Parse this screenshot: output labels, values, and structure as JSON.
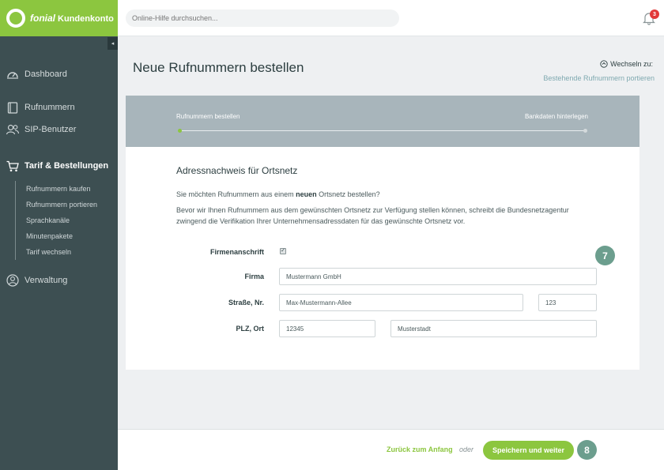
{
  "brand": {
    "name_italic": "fonial",
    "name_rest": "Kundenkonto"
  },
  "search": {
    "placeholder": "Online-Hilfe durchsuchen..."
  },
  "notifications": {
    "count": "3"
  },
  "sidebar": {
    "collapse_icon": "◂",
    "items": [
      {
        "label": "Dashboard",
        "icon": "speedometer-icon"
      },
      {
        "label": "Rufnummern",
        "icon": "phone-book-icon"
      },
      {
        "label": "SIP-Benutzer",
        "icon": "users-icon"
      },
      {
        "label": "Tarif & Bestellungen",
        "icon": "cart-icon"
      },
      {
        "label": "Verwaltung",
        "icon": "user-circle-icon"
      }
    ],
    "submenu": [
      "Rufnummern kaufen",
      "Rufnummern portieren",
      "Sprachkanäle",
      "Minutenpakete",
      "Tarif wechseln"
    ]
  },
  "header": {
    "title": "Neue Rufnummern bestellen",
    "switch_label": "Wechseln zu:",
    "switch_link": "Bestehende Rufnummern portieren"
  },
  "stepper": {
    "step1": "Rufnummern bestellen",
    "step2": "Bankdaten hinterlegen",
    "colors": {
      "active": "#8cc63f",
      "inactive": "#e8edef"
    }
  },
  "form": {
    "section_title": "Adressnachweis für Ortsnetz",
    "intro_pre": "Sie möchten Rufnummern aus einem ",
    "intro_bold": "neuen",
    "intro_post": " Ortsnetz bestellen?",
    "intro_line2": "Bevor wir Ihnen Rufnummern aus dem gewünschten Ortsnetz zur Verfügung stellen können, schreibt die Bundesnetzagentur",
    "intro_line3": "zwingend die Verifikation Ihrer Unternehmensadressdaten für das gewünschte Ortsnetz vor.",
    "firmenanschrift_label": "Firmenanschrift",
    "firmenanschrift_checked": true,
    "firma_label": "Firma",
    "firma_value": "Mustermann GmbH",
    "strasse_label": "Straße, Nr.",
    "strasse_value": "Max-Mustermann-Allee",
    "nr_value": "123",
    "plz_label": "PLZ, Ort",
    "plz_value": "12345",
    "ort_value": "Musterstadt",
    "bubble_form": "7"
  },
  "footer": {
    "back_label": "Zurück zum Anfang",
    "or_label": "oder",
    "save_label": "Speichern und weiter",
    "bubble_footer": "8"
  },
  "colors": {
    "brand_green": "#8cc63f",
    "sidebar_bg": "#3d4f52",
    "bubble": "#6c9e8e",
    "badge": "#e23a3a"
  }
}
